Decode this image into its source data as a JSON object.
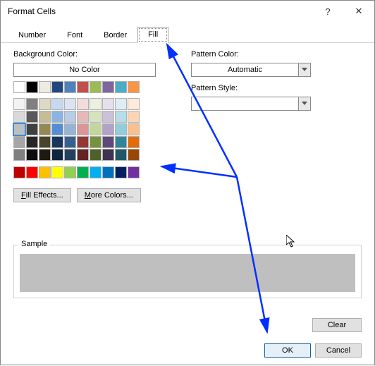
{
  "title": "Format Cells",
  "help_symbol": "?",
  "close_symbol": "✕",
  "tabs": [
    "Number",
    "Font",
    "Border",
    "Fill"
  ],
  "active_tab": "Fill",
  "labels": {
    "background_color": "Background Color:",
    "pattern_color": "Pattern Color:",
    "pattern_style": "Pattern Style:",
    "sample": "Sample"
  },
  "no_color_label": "No Color",
  "fill_effects_label": "Fill Effects...",
  "more_colors_label": "More Colors...",
  "pattern_color_value": "Automatic",
  "pattern_style_value": "",
  "sample_color": "#bfbfbf",
  "clear_label": "Clear",
  "ok_label": "OK",
  "cancel_label": "Cancel",
  "palette_theme": [
    [
      "#ffffff",
      "#000000",
      "#eeece1",
      "#1f497d",
      "#4f81bd",
      "#c0504d",
      "#9bbb59",
      "#8064a2",
      "#4bacc6",
      "#f79646"
    ],
    [
      "#f2f2f2",
      "#808080",
      "#ddd9c3",
      "#c6d9f0",
      "#dbe5f1",
      "#f2dcdb",
      "#ebf1dd",
      "#e5e0ec",
      "#dbeef3",
      "#fdeada"
    ],
    [
      "#d9d9d9",
      "#595959",
      "#c4bd97",
      "#8db3e2",
      "#b8cce4",
      "#e5b9b7",
      "#d7e3bc",
      "#ccc1d9",
      "#b7dde8",
      "#fbd5b5"
    ],
    [
      "#bfbfbf",
      "#404040",
      "#938953",
      "#548dd4",
      "#95b3d7",
      "#d99694",
      "#c3d69b",
      "#b2a2c7",
      "#92cddc",
      "#fac08f"
    ],
    [
      "#a6a6a6",
      "#262626",
      "#494429",
      "#17365d",
      "#366092",
      "#953734",
      "#76923c",
      "#5f497a",
      "#31859b",
      "#e36c09"
    ],
    [
      "#808080",
      "#0d0d0d",
      "#1d1b10",
      "#0f243e",
      "#244061",
      "#632423",
      "#4f6128",
      "#3f3151",
      "#205867",
      "#974806"
    ]
  ],
  "palette_standard": [
    "#c00000",
    "#ff0000",
    "#ffc000",
    "#ffff00",
    "#92d050",
    "#00b050",
    "#00b0f0",
    "#0070c0",
    "#002060",
    "#7030a0"
  ],
  "selected_swatch": {
    "row": 3,
    "col": 0
  }
}
